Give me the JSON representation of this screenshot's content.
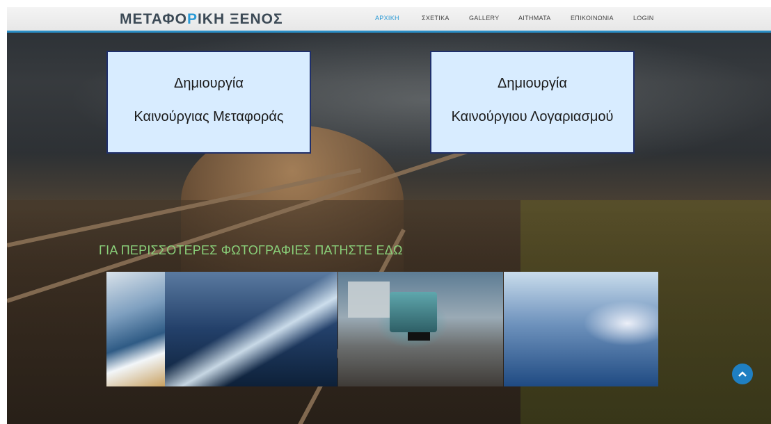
{
  "header": {
    "logo_part1": "ΜΕΤΑΦΟ",
    "logo_accent": "Ρ",
    "logo_part2": "ΙΚΗ ΞΕΝΟΣ",
    "nav": [
      "ΑΡΧΙΚΗ",
      "ΣΧΕΤΙΚΑ",
      "GALLERY",
      "ΑΙΤΗΜΑΤΑ",
      "ΕΠΙΚΟΙΝΩΝΙΑ",
      "LOGIN"
    ],
    "active": "ΑΡΧΙΚΗ"
  },
  "cards": [
    {
      "line1": "Δημιουργία",
      "line2": "Καινούργιας Μεταφοράς"
    },
    {
      "line1": "Δημιουργία",
      "line2": "Καινούργιου Λογαριασμού"
    }
  ],
  "gallery": {
    "title": "ΓΙΑ ΠΕΡΙΣΣΟΤΕΡΕΣ ΦΩΤΟΓΡΑΦΙΕΣ ΠΑΤΗΣΤΕ ΕΔΩ",
    "photos": [
      "wave",
      "city-light-trails",
      "truck-highway",
      "transport-collage"
    ]
  },
  "colors": {
    "accent": "#2a9ad6",
    "gallery_title": "#8ad07a",
    "card_bg": "#d8ecff",
    "card_border": "#1f2f6a"
  },
  "icons": {
    "scroll_top": "chevron-up-icon"
  }
}
